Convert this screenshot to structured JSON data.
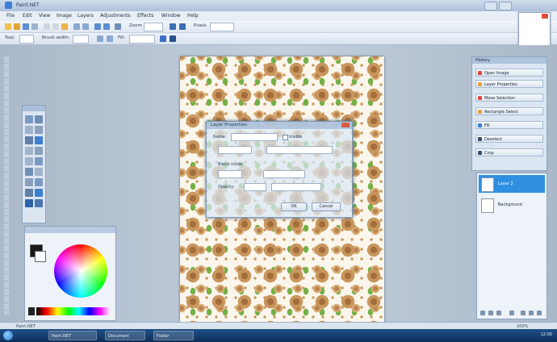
{
  "window": {
    "title": "Paint.NET"
  },
  "menu": [
    "File",
    "Edit",
    "View",
    "Image",
    "Layers",
    "Adjustments",
    "Effects",
    "Window",
    "Help"
  ],
  "toolbar": {
    "zoom_label": "Zoom",
    "units_label": "Pixels"
  },
  "toolbar2": {
    "tool_label": "Tool:",
    "brush_label": "Brush width:",
    "fill_label": "Fill:"
  },
  "dialog": {
    "title": "Layer Properties",
    "name_label": "Name:",
    "visible_label": "Visible",
    "blend_label": "Blend mode:",
    "opacity_label": "Opacity:",
    "ok": "OK",
    "cancel": "Cancel"
  },
  "history_panel": {
    "title": "History",
    "items": [
      "Open Image",
      "Layer Properties",
      "Move Selection",
      "Rectangle Select",
      "Fill",
      "Deselect",
      "Crop"
    ]
  },
  "layers_panel": {
    "layers": [
      "Layer 2",
      "Background"
    ]
  },
  "status": {
    "left": "Paint.NET",
    "right": "100%"
  },
  "taskbar": {
    "items": [
      "Paint.NET",
      "Document",
      "Folder"
    ],
    "clock": "12:00"
  }
}
